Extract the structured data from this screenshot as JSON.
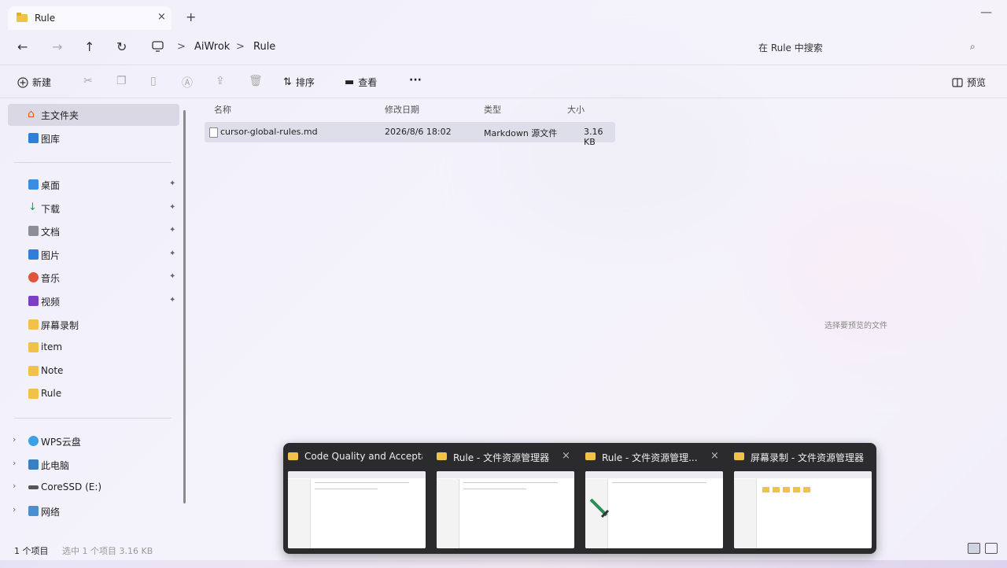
{
  "tab": {
    "title": "Rule",
    "close": "×",
    "new_tab": "+",
    "minimize": "—"
  },
  "address": {
    "back": "←",
    "forward": "→",
    "up": "↑",
    "refresh": "↻",
    "crumbs": [
      "AiWrok",
      "Rule"
    ],
    "separator": ">",
    "search_placeholder": "在 Rule 中搜索",
    "search_icon": "⌕"
  },
  "toolbar": {
    "new_label": "新建",
    "sort_label": "排序",
    "view_label": "查看",
    "more": "···",
    "preview_label": "预览"
  },
  "sidebar": {
    "home": "主文件夹",
    "gallery": "图库",
    "pinned": [
      {
        "label": "桌面",
        "color": "#3a8de0"
      },
      {
        "label": "下载",
        "color": "#2b9a5a"
      },
      {
        "label": "文档",
        "color": "#8e8e9a"
      },
      {
        "label": "图片",
        "color": "#2f7fd8"
      },
      {
        "label": "音乐",
        "color": "#e0543a"
      },
      {
        "label": "视频",
        "color": "#7b3fc4"
      }
    ],
    "folders": [
      "屏幕录制",
      "item",
      "Note",
      "Rule"
    ],
    "drives": [
      {
        "label": "WPS云盘",
        "color": "#3aa0e8"
      },
      {
        "label": "此电脑",
        "color": "#3a7fc0"
      },
      {
        "label": "CoreSSD (E:)",
        "color": "#555555"
      },
      {
        "label": "网络",
        "color": "#4a8fd0"
      }
    ],
    "pin_glyph": "📌",
    "chev": "›"
  },
  "columns": {
    "name": "名称",
    "modified": "修改日期",
    "type": "类型",
    "size": "大小"
  },
  "files": [
    {
      "name": "cursor-global-rules.md",
      "modified": "2026/8/6 18:02",
      "type": "Markdown 源文件",
      "size": "3.16 KB"
    }
  ],
  "preview_note": "选择要预览的文件",
  "status": {
    "count": "1 个项目",
    "selection": "选中 1 个项目  3.16 KB"
  },
  "taskbar_windows": [
    {
      "title": "Code Quality and Accepta..."
    },
    {
      "title": "Rule - 文件资源管理器"
    },
    {
      "title": "Rule - 文件资源管理..."
    },
    {
      "title": "屏幕录制 - 文件资源管理器"
    }
  ],
  "colors": {
    "folder": "#f0c24a",
    "accent": "#2b2b2e"
  }
}
